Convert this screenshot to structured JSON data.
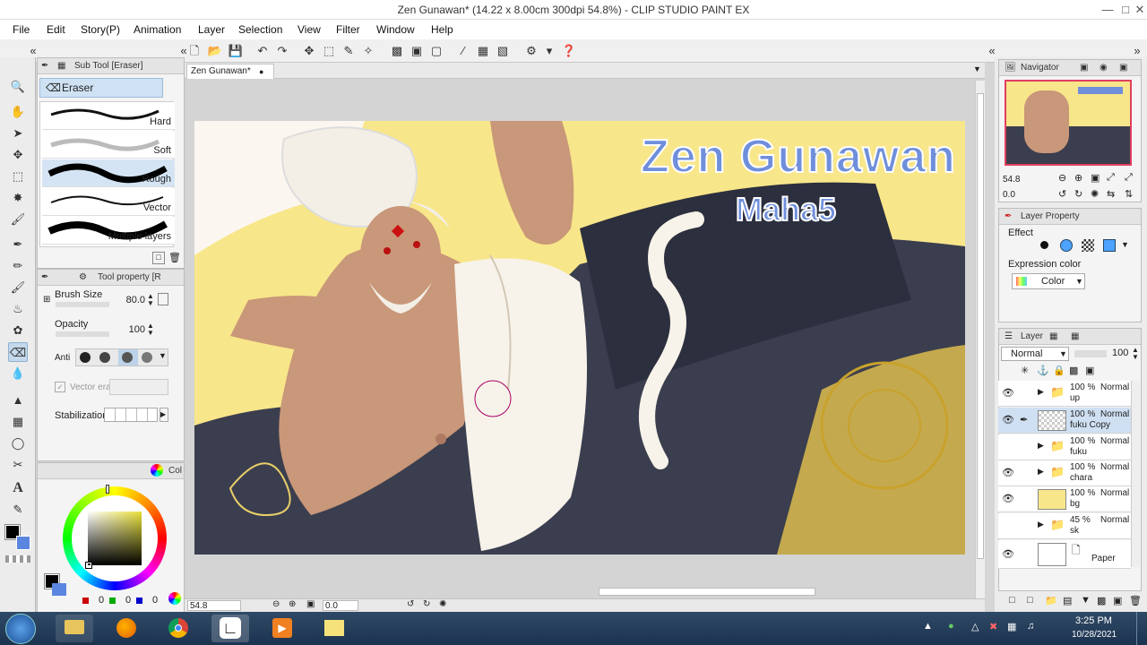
{
  "window": {
    "title": "Zen Gunawan* (14.22 x 8.00cm 300dpi 54.8%) - CLIP STUDIO PAINT EX"
  },
  "menu": [
    "File",
    "Edit",
    "Story(P)",
    "Animation",
    "Layer",
    "Selection",
    "View",
    "Filter",
    "Window",
    "Help"
  ],
  "subtool": {
    "header": "Sub Tool [Eraser]",
    "group": "Eraser",
    "brushes": [
      "Hard",
      "Soft",
      "Rough",
      "Vector",
      "Multiple layers"
    ],
    "selected": "Rough"
  },
  "toolprop": {
    "header": "Tool property [R",
    "brush_size_label": "Brush Size",
    "brush_size_value": "80.0",
    "opacity_label": "Opacity",
    "opacity_value": "100",
    "antialias_label": "Anti",
    "vector_label": "Vector era",
    "stabilization_label": "Stabilization"
  },
  "color": {
    "header": "Col",
    "main": "#000000",
    "sub": "#5b86e0",
    "values": [
      "0",
      "0",
      "0"
    ]
  },
  "document": {
    "tab": "Zen Gunawan*",
    "artwork_title": "Zen Gunawan",
    "artwork_subtitle": "Maha5",
    "zoom": "54.8",
    "angle": "0.0"
  },
  "navigator": {
    "header": "Navigator",
    "zoom": "54.8",
    "angle": "0.0"
  },
  "layer_property": {
    "header": "Layer Property",
    "effect_label": "Effect",
    "expression_label": "Expression color",
    "expression_value": "Color"
  },
  "layers": {
    "header": "Layer",
    "blend_mode": "Normal",
    "opacity": "100",
    "items": [
      {
        "pct": "100 %",
        "mode": "Normal",
        "name": "up",
        "type": "folder",
        "visible": true,
        "selected": false
      },
      {
        "pct": "100 %",
        "mode": "Normal",
        "name": "fuku Copy",
        "type": "raster",
        "visible": true,
        "selected": true
      },
      {
        "pct": "100 %",
        "mode": "Normal",
        "name": "fuku",
        "type": "folder",
        "visible": false,
        "selected": false
      },
      {
        "pct": "100 %",
        "mode": "Normal",
        "name": "chara",
        "type": "folder",
        "visible": true,
        "selected": false
      },
      {
        "pct": "100 %",
        "mode": "Normal",
        "name": "bg",
        "type": "fill",
        "visible": true,
        "selected": false
      },
      {
        "pct": "45 %",
        "mode": "Normal",
        "name": "sk",
        "type": "folder",
        "visible": false,
        "selected": false
      },
      {
        "pct": "",
        "mode": "",
        "name": "Paper",
        "type": "paper",
        "visible": true,
        "selected": false
      }
    ]
  },
  "taskbar": {
    "time": "3:25 PM",
    "date": "10/28/2021"
  }
}
